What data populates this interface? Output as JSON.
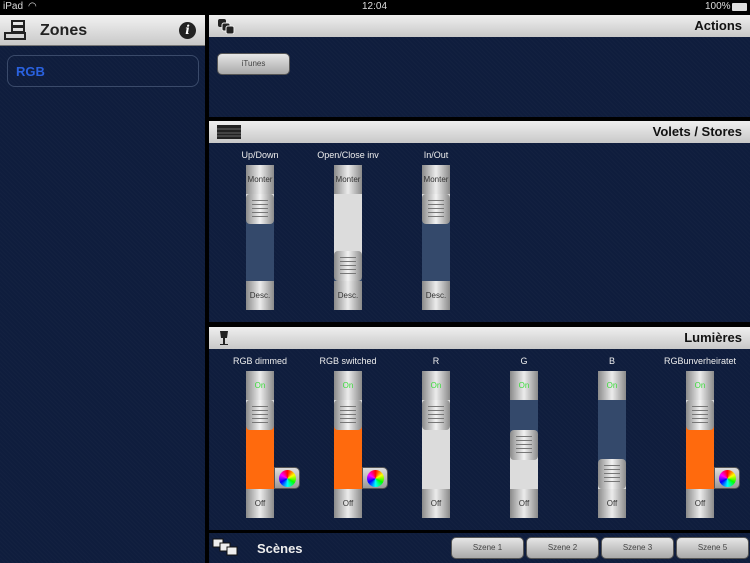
{
  "status": {
    "device": "iPad",
    "time": "12:04",
    "battery": "100%"
  },
  "zones": {
    "title": "Zones",
    "items": [
      {
        "label": "RGB"
      }
    ]
  },
  "actions": {
    "title": "Actions",
    "buttons": [
      "iTunes"
    ]
  },
  "volets": {
    "title": "Volets / Stores",
    "sliders": [
      {
        "label": "Up/Down",
        "top": "Monter",
        "bottom": "Desc.",
        "value": 1.0,
        "above": "#d9d9d9",
        "below": "#34496b"
      },
      {
        "label": "Open/Close inv",
        "top": "Monter",
        "bottom": "Desc.",
        "value": 0.0,
        "above": "#dcdcdc",
        "below": "#34496b"
      },
      {
        "label": "In/Out",
        "top": "Monter",
        "bottom": "Desc.",
        "value": 1.0,
        "above": "#d9d9d9",
        "below": "#34496b"
      }
    ]
  },
  "lumieres": {
    "title": "Lumières",
    "sliders": [
      {
        "label": "RGB dimmed",
        "top": "On",
        "bottom": "Off",
        "value": 1.0,
        "above": "#d9d9d9",
        "below": "#ff6a0d",
        "color_wheel": true
      },
      {
        "label": "RGB switched",
        "top": "On",
        "bottom": "Off",
        "value": 1.0,
        "above": "#d9d9d9",
        "below": "#ff6a0d",
        "color_wheel": true
      },
      {
        "label": "R",
        "top": "On",
        "bottom": "Off",
        "value": 1.0,
        "above": "#d9d9d9",
        "below": "#dcdcdc",
        "color_wheel": false
      },
      {
        "label": "G",
        "top": "On",
        "bottom": "Off",
        "value": 0.5,
        "above": "#34496b",
        "below": "#dcdcdc",
        "color_wheel": false
      },
      {
        "label": "B",
        "top": "On",
        "bottom": "Off",
        "value": 0.0,
        "above": "#34496b",
        "below": "#dcdcdc",
        "color_wheel": false
      },
      {
        "label": "RGBunverheiratet",
        "top": "On",
        "bottom": "Off",
        "value": 1.0,
        "above": "#d9d9d9",
        "below": "#ff6a0d",
        "color_wheel": true
      }
    ]
  },
  "scenes": {
    "title": "Scènes",
    "buttons": [
      "Szene 1",
      "Szene 2",
      "Szene 3",
      "Szene 5"
    ]
  }
}
